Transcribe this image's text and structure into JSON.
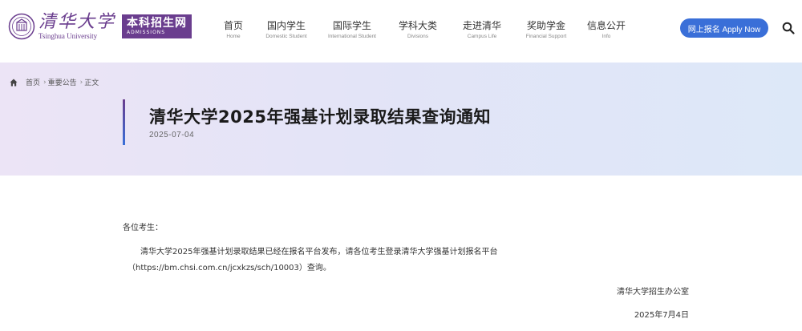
{
  "header": {
    "logo_cn": "清华大学",
    "logo_en": "Tsinghua University",
    "admissions_cn": "本科招生网",
    "admissions_en": "ADMISSIONS",
    "nav": [
      {
        "cn": "首页",
        "en": "Home"
      },
      {
        "cn": "国内学生",
        "en": "Domestic Student"
      },
      {
        "cn": "国际学生",
        "en": "International Student"
      },
      {
        "cn": "学科大类",
        "en": "Divisions"
      },
      {
        "cn": "走进清华",
        "en": "Campus Life"
      },
      {
        "cn": "奖助学金",
        "en": "Financial Support"
      },
      {
        "cn": "信息公开",
        "en": "Info"
      }
    ],
    "apply_label": "网上报名 Apply Now"
  },
  "breadcrumb": {
    "items": [
      "首页",
      "重要公告",
      "正文"
    ]
  },
  "article": {
    "title": "清华大学2025年强基计划录取结果查询通知",
    "date": "2025-07-04",
    "greeting": "各位考生：",
    "para1": "清华大学2025年强基计划录取结果已经在报名平台发布，请各位考生登录清华大学强基计划报名平台",
    "para2": "（https://bm.chsi.com.cn/jcxkzs/sch/10003）查询。",
    "sign_org": "清华大学招生办公室",
    "sign_date": "2025年7月4日"
  },
  "colors": {
    "brand_purple": "#6a3d8e",
    "apply_blue": "#3a6fd8"
  }
}
